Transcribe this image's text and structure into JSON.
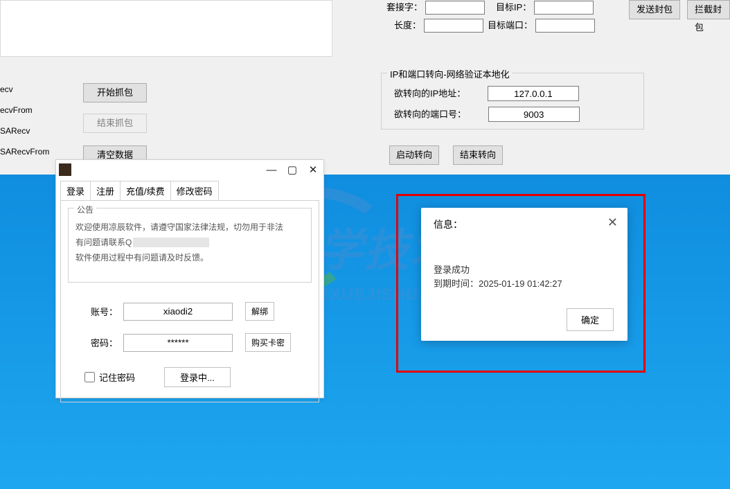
{
  "top": {
    "socket_label": "套接字：",
    "length_label": "长度：",
    "target_ip_label": "目标IP：",
    "target_port_label": "目标端口：",
    "socket_value": "",
    "length_value": "",
    "target_ip_value": "",
    "target_port_value": "",
    "send_btn": "发送封包",
    "intercept_btn": "拦截封包"
  },
  "leftlist": {
    "i0": "ecv",
    "i1": "ecvFrom",
    "i2": "SARecv",
    "i3": "SARecvFrom"
  },
  "capture": {
    "start": "开始抓包",
    "end": "结束抓包",
    "clear": "清空数据"
  },
  "redirect": {
    "group_title": "IP和端口转向-网络验证本地化",
    "ip_label": "欲转向的IP地址：",
    "ip_value": "127.0.0.1",
    "port_label": "欲转向的端口号：",
    "port_value": "9003",
    "start_btn": "启动转向",
    "end_btn": "结束转向"
  },
  "login": {
    "tabs": {
      "t0": "登录",
      "t1": "注册",
      "t2": "充值/续费",
      "t3": "修改密码"
    },
    "notice_title": "公告",
    "notice_line1": "欢迎使用凉辰软件，请遵守国家法律法规，切勿用于非法",
    "notice_line2": "有问题请联系Q",
    "notice_line3": "软件使用过程中有问题请及时反馈。",
    "account_label": "账号：",
    "account_value": "xiaodi2",
    "unbind_btn": "解绑",
    "password_label": "密码：",
    "password_value": "******",
    "buykey_btn": "购买卡密",
    "remember_label": "记住密码",
    "login_btn": "登录中..."
  },
  "msgbox": {
    "title": "信息：",
    "line1": "登录成功",
    "line2_prefix": "到期时间：",
    "line2_value": "2025-01-19 01:42:27",
    "ok": "确定"
  },
  "watermark": {
    "big": "学技术",
    "url": "WWW.52XUEJISHU.COM"
  }
}
